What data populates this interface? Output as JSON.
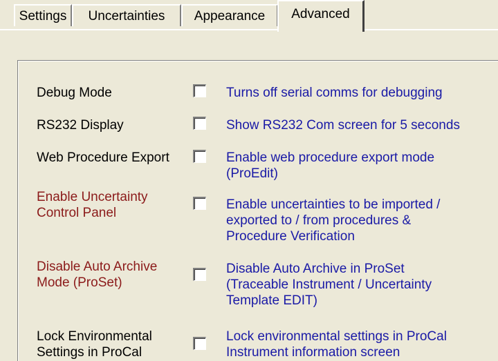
{
  "tabs": [
    {
      "label": "Settings",
      "active": false
    },
    {
      "label": "Uncertainties",
      "active": false
    },
    {
      "label": "Appearance",
      "active": false
    },
    {
      "label": "Advanced",
      "active": true
    }
  ],
  "options": [
    {
      "label_lines": [
        "Debug Mode"
      ],
      "label_color": "#000000",
      "checked": false,
      "desc_lines": [
        "Turns off serial comms for debugging"
      ]
    },
    {
      "label_lines": [
        "RS232 Display"
      ],
      "label_color": "#000000",
      "checked": false,
      "desc_lines": [
        "Show RS232 Com screen for 5 seconds"
      ]
    },
    {
      "label_lines": [
        "Web Procedure Export"
      ],
      "label_color": "#000000",
      "checked": false,
      "desc_lines": [
        "Enable web procedure export mode",
        "(ProEdit)"
      ]
    },
    {
      "label_lines": [
        "Enable Uncertainty",
        "Control Panel"
      ],
      "label_color": "#8b1a1a",
      "checked": false,
      "desc_lines": [
        "Enable uncertainties to be imported /",
        "exported to / from procedures &",
        "Procedure Verification"
      ]
    },
    {
      "label_lines": [
        "Disable Auto Archive",
        "Mode (ProSet)"
      ],
      "label_color": "#8b1a1a",
      "checked": false,
      "desc_lines": [
        "Disable Auto Archive in ProSet",
        "(Traceable Instrument / Uncertainty",
        "Template EDIT)"
      ]
    },
    {
      "label_lines": [
        "Lock Environmental",
        "Settings in ProCal"
      ],
      "label_color": "#000000",
      "checked": false,
      "desc_lines": [
        "Lock environmental settings in ProCal",
        "Instrument information screen"
      ]
    }
  ],
  "colors": {
    "background": "#ece9d8",
    "description_text": "#1a1aa6",
    "highlight_label": "#8b1a1a"
  }
}
